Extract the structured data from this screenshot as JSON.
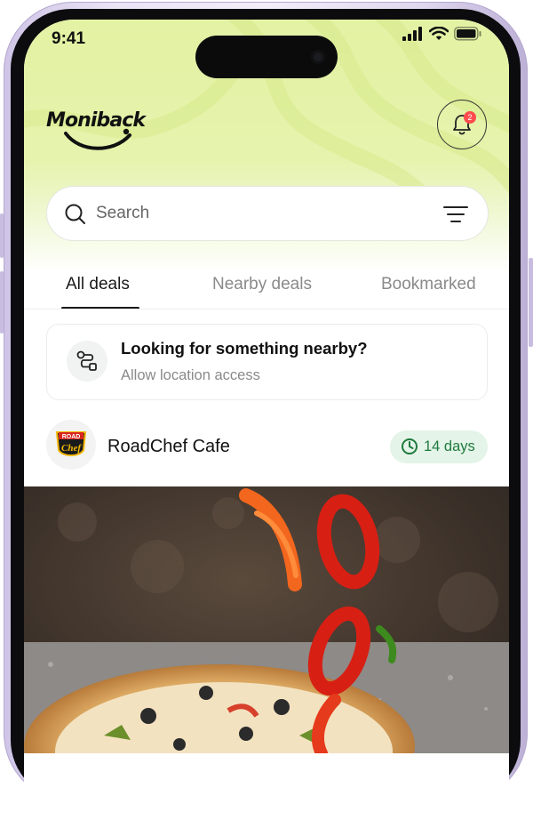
{
  "status_bar": {
    "time": "9:41"
  },
  "brand": {
    "name": "Moniback",
    "accent": "#e3f2a3"
  },
  "notifications": {
    "count": "2",
    "icon": "bell-icon"
  },
  "search": {
    "placeholder": "Search",
    "icon": "search-icon",
    "filter_icon": "filter-icon"
  },
  "tabs": [
    {
      "label": "All deals",
      "active": true
    },
    {
      "label": "Nearby deals",
      "active": false
    },
    {
      "label": "Bookmarked",
      "active": false
    }
  ],
  "nearby_prompt": {
    "title": "Looking for something nearby?",
    "subtitle": "Allow location access",
    "icon": "route-icon"
  },
  "deal": {
    "merchant": "RoadChef Cafe",
    "merchant_logo_top": "ROAD",
    "merchant_logo_bottom": "Chef",
    "expires": "14 days",
    "expires_color": "#1f7a3e",
    "image": "pizza with falling bell pepper slices"
  }
}
